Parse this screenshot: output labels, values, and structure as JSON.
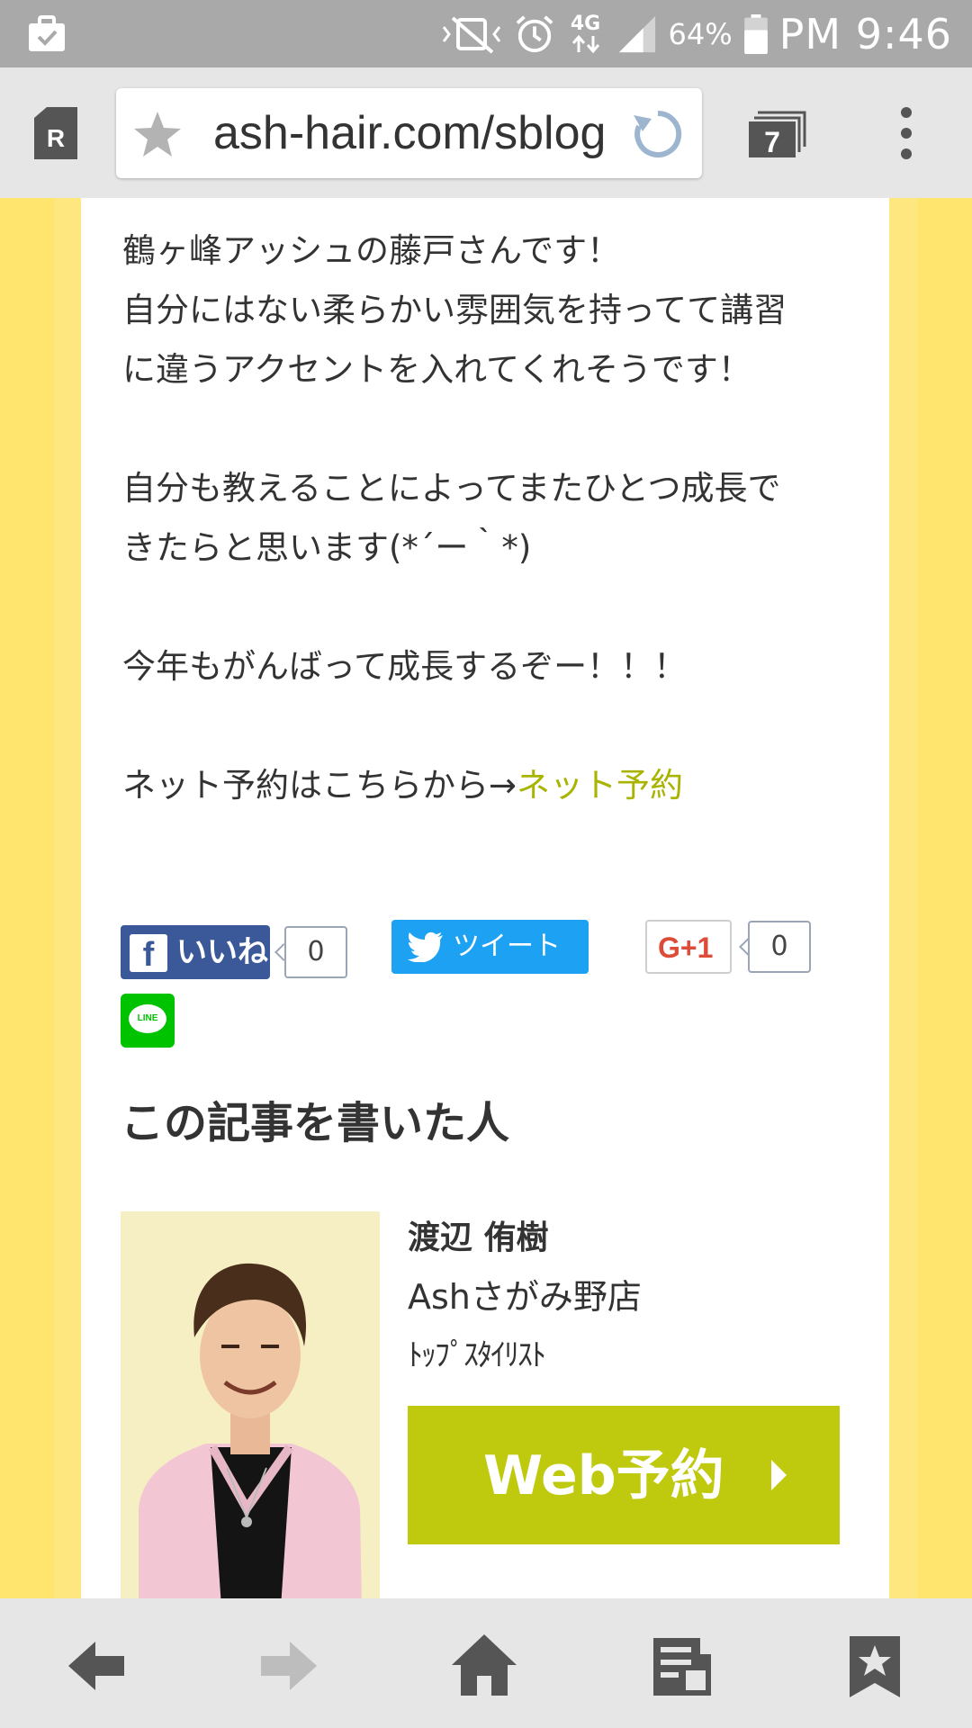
{
  "status_bar": {
    "network": "4G",
    "battery_percent": "64%",
    "time": "PM 9:46",
    "signal_level": 3,
    "icons": [
      "briefcase-check-icon",
      "vibrate-mute-icon",
      "alarm-icon",
      "network-arrows-icon",
      "signal-icon",
      "battery-icon"
    ]
  },
  "browser": {
    "url": "ash-hair.com/sblog",
    "tab_count": "7",
    "reader_letter": "R",
    "icons": [
      "reader-mode-icon",
      "bookmark-star-icon",
      "reload-icon",
      "tabs-icon",
      "overflow-menu-icon"
    ]
  },
  "article": {
    "para1": [
      "鶴ヶ峰アッシュの藤戸さんです！",
      "自分にはない柔らかい雰囲気を持ってて講習",
      "に違うアクセントを入れてくれそうです！"
    ],
    "para2": [
      "自分も教えることによってまたひとつ成長で",
      "きたらと思います(*´ー｀*)"
    ],
    "para3": "今年もがんばって成長するぞー！！！",
    "reservation_prefix": "ネット予約はこちらから→",
    "reservation_link": "ネット予約"
  },
  "social": {
    "facebook_label": "いいね",
    "facebook_count": "0",
    "twitter_label": "ツイート",
    "gplus_label": "G+1",
    "gplus_count": "0",
    "line_label": "LINE"
  },
  "author": {
    "section_title": "この記事を書いた人",
    "name": "渡辺 侑樹",
    "shop": "Ashさがみ野店",
    "role": "ﾄｯﾌﾟｽﾀｲﾘｽﾄ",
    "booking_button": "Web予約"
  },
  "bottom_nav": {
    "icons": [
      "back-arrow-icon",
      "forward-arrow-icon",
      "home-icon",
      "saved-pages-icon",
      "bookmarks-icon"
    ]
  },
  "colors": {
    "page_yellow": "#ffe46d",
    "link_green": "#a8b400",
    "web_button": "#bfc90e",
    "facebook": "#3b5998",
    "twitter": "#1da1f2",
    "line": "#00c300",
    "gplus": "#dd4b39"
  }
}
